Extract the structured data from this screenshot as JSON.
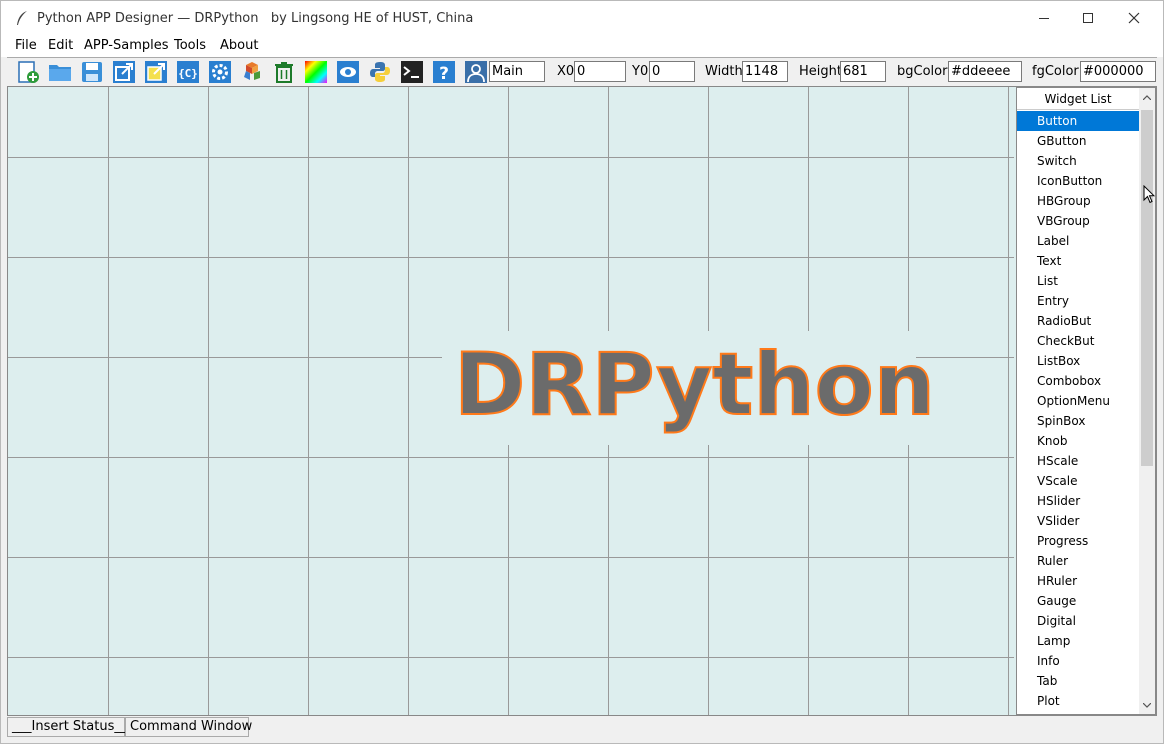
{
  "window": {
    "title": "Python APP Designer — DRPython   by Lingsong HE of HUST, China",
    "minimize_icon": "minimize-icon",
    "maximize_icon": "maximize-icon",
    "close_icon": "close-icon"
  },
  "menu": [
    "File",
    "Edit",
    "APP-Samples",
    "Tools",
    "About"
  ],
  "toolbar": {
    "icons": [
      "new-file-icon",
      "open-folder-icon",
      "save-icon",
      "export-icon",
      "export-alt-icon",
      "code-icon",
      "settings-gear-icon",
      "cubes-icon",
      "trash-icon",
      "color-spectrum-icon",
      "eye-icon",
      "python-logo-icon",
      "terminal-icon",
      "help-icon",
      "user-icon"
    ],
    "name_value": "Main",
    "x0_label": "X0",
    "x0_value": "0",
    "y0_label": "Y0",
    "y0_value": "0",
    "width_label": "Width",
    "width_value": "1148",
    "height_label": "Height",
    "height_value": "681",
    "bgcolor_label": "bgColor",
    "bgcolor_value": "#ddeeee",
    "fgcolor_label": "fgColor",
    "fgcolor_value": "#000000"
  },
  "canvas": {
    "logo_text": "DRPython",
    "bg_color": "#ddeeee",
    "logo_fill": "#6b6b6b",
    "logo_stroke": "#ff7a1a"
  },
  "widget_list": {
    "header": "Widget List",
    "selected": "Button",
    "items": [
      "Button",
      "GButton",
      "Switch",
      "IconButton",
      "HBGroup",
      "VBGroup",
      "Label",
      "Text",
      "List",
      "Entry",
      "RadioBut",
      "CheckBut",
      "ListBox",
      "Combobox",
      "OptionMenu",
      "SpinBox",
      "Knob",
      "HScale",
      "VScale",
      "HSlider",
      "VSlider",
      "Progress",
      "Ruler",
      "HRuler",
      "Gauge",
      "Digital",
      "Lamp",
      "Info",
      "Tab",
      "Plot"
    ]
  },
  "status": {
    "insert_status": "___Insert Status___",
    "command_window": "Command Window"
  },
  "colors": {
    "selection": "#0078d7"
  }
}
